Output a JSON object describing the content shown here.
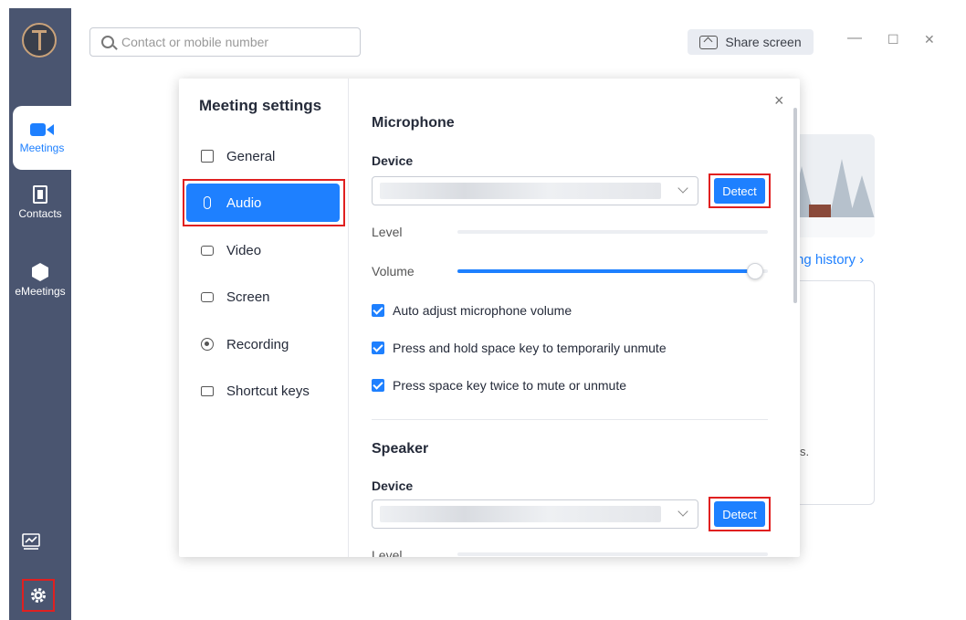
{
  "sidebar": {
    "items": [
      {
        "label": "Meetings",
        "icon": "video-camera-icon",
        "active": true
      },
      {
        "label": "Contacts",
        "icon": "contacts-icon"
      },
      {
        "label": "eMeetings",
        "icon": "cube-icon"
      }
    ],
    "bottom": [
      {
        "icon": "chart-icon"
      },
      {
        "icon": "gear-icon"
      }
    ]
  },
  "topbar": {
    "search_placeholder": "Contact or mobile number",
    "share_label": "Share screen",
    "minimize": "—",
    "maximize": "☐",
    "close": "✕"
  },
  "background": {
    "history_link": "ng history ›",
    "fragment": "s."
  },
  "dialog": {
    "title": "Meeting settings",
    "close": "×",
    "nav": [
      {
        "label": "General",
        "icon": "general-icon"
      },
      {
        "label": "Audio",
        "icon": "microphone-icon",
        "active": true
      },
      {
        "label": "Video",
        "icon": "video-icon"
      },
      {
        "label": "Screen",
        "icon": "screen-icon"
      },
      {
        "label": "Recording",
        "icon": "recording-icon"
      },
      {
        "label": "Shortcut keys",
        "icon": "keyboard-icon"
      }
    ],
    "microphone": {
      "heading": "Microphone",
      "device_label": "Device",
      "detect_label": "Detect",
      "level_label": "Level",
      "volume_label": "Volume",
      "volume_value": 0.96,
      "options": [
        {
          "label": "Auto adjust microphone volume",
          "checked": true
        },
        {
          "label": "Press and hold space key to temporarily unmute",
          "checked": true
        },
        {
          "label": "Press space key twice to mute or unmute",
          "checked": true
        }
      ]
    },
    "speaker": {
      "heading": "Speaker",
      "device_label": "Device",
      "detect_label": "Detect",
      "level_label": "Level"
    }
  },
  "colors": {
    "accent": "#1e80ff",
    "sidebar": "#4a5570",
    "highlight": "#e02020"
  }
}
